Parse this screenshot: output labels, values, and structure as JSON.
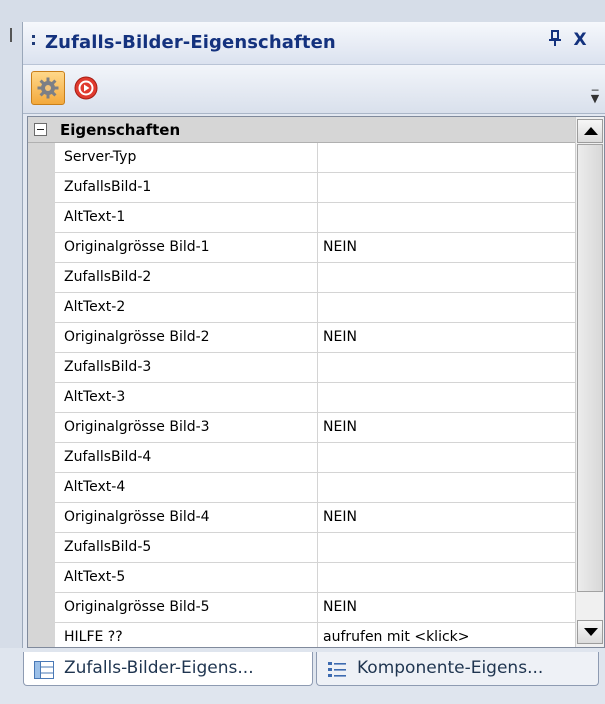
{
  "panel": {
    "title": "Zufalls-Bilder-Eigenschaften",
    "pin_label": "1",
    "close_label": "X"
  },
  "toolbar": {
    "buttons": [
      {
        "name": "properties-button",
        "icon": "gear-icon",
        "active": true
      },
      {
        "name": "events-button",
        "icon": "lightning-icon",
        "active": false
      }
    ]
  },
  "grid": {
    "category": "Eigenschaften",
    "rows": [
      {
        "name": "Server-Typ",
        "value": ""
      },
      {
        "name": "ZufallsBild-1",
        "value": ""
      },
      {
        "name": "AltText-1",
        "value": ""
      },
      {
        "name": "Originalgrösse Bild-1",
        "value": "NEIN"
      },
      {
        "name": "ZufallsBild-2",
        "value": ""
      },
      {
        "name": "AltText-2",
        "value": ""
      },
      {
        "name": "Originalgrösse Bild-2",
        "value": "NEIN"
      },
      {
        "name": "ZufallsBild-3",
        "value": ""
      },
      {
        "name": "AltText-3",
        "value": ""
      },
      {
        "name": "Originalgrösse Bild-3",
        "value": "NEIN"
      },
      {
        "name": "ZufallsBild-4",
        "value": ""
      },
      {
        "name": "AltText-4",
        "value": ""
      },
      {
        "name": "Originalgrösse Bild-4",
        "value": "NEIN"
      },
      {
        "name": "ZufallsBild-5",
        "value": ""
      },
      {
        "name": "AltText-5",
        "value": ""
      },
      {
        "name": "Originalgrösse Bild-5",
        "value": "NEIN"
      },
      {
        "name": "HILFE ??",
        "value": "aufrufen mit <klick>"
      }
    ]
  },
  "tabs": [
    {
      "label": "Zufalls-Bilder-Eigens...",
      "active": true,
      "icon": "property-grid-icon"
    },
    {
      "label": "Komponente-Eigens...",
      "active": false,
      "icon": "component-list-icon"
    }
  ],
  "colors": {
    "title_text": "#14327e",
    "active_button": "#f3a93c",
    "category_bg": "#d6d6d6",
    "event_icon": "#e03a2e"
  }
}
